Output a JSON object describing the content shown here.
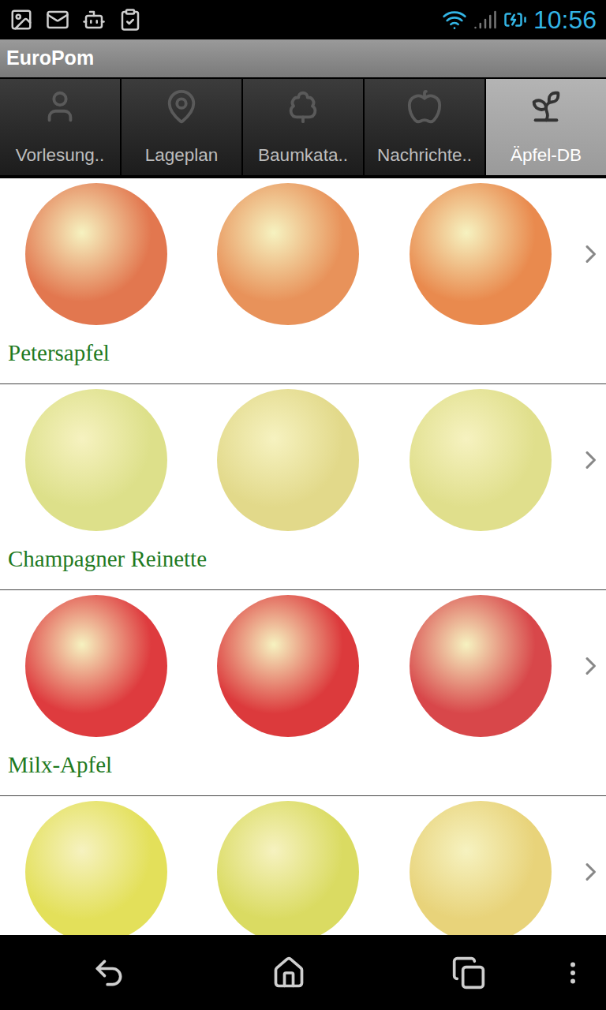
{
  "status_bar": {
    "time": "10:56"
  },
  "app_bar": {
    "title": "EuroPom"
  },
  "tabs": [
    {
      "label": "Vorlesung..",
      "selected": false
    },
    {
      "label": "Lageplan",
      "selected": false
    },
    {
      "label": "Baumkata..",
      "selected": false
    },
    {
      "label": "Nachrichte..",
      "selected": false
    },
    {
      "label": "Äpfel-DB",
      "selected": true
    }
  ],
  "apples": [
    {
      "name": "Petersapfel",
      "photos": [
        {
          "color": "#e2774f"
        },
        {
          "color": "#e8925a"
        },
        {
          "color": "#e98a4e"
        }
      ]
    },
    {
      "name": "Champagner Reinette",
      "photos": [
        {
          "color": "#dde08a"
        },
        {
          "color": "#e2d98a"
        },
        {
          "color": "#e0df8c"
        }
      ]
    },
    {
      "name": "Milx-Apfel",
      "photos": [
        {
          "color": "#de3b3e"
        },
        {
          "color": "#dc3a3c"
        },
        {
          "color": "#d8474a"
        }
      ]
    },
    {
      "photos": [
        {
          "color": "#e3e05a"
        },
        {
          "color": "#dadb62"
        },
        {
          "color": "#e8d37a"
        }
      ]
    }
  ]
}
